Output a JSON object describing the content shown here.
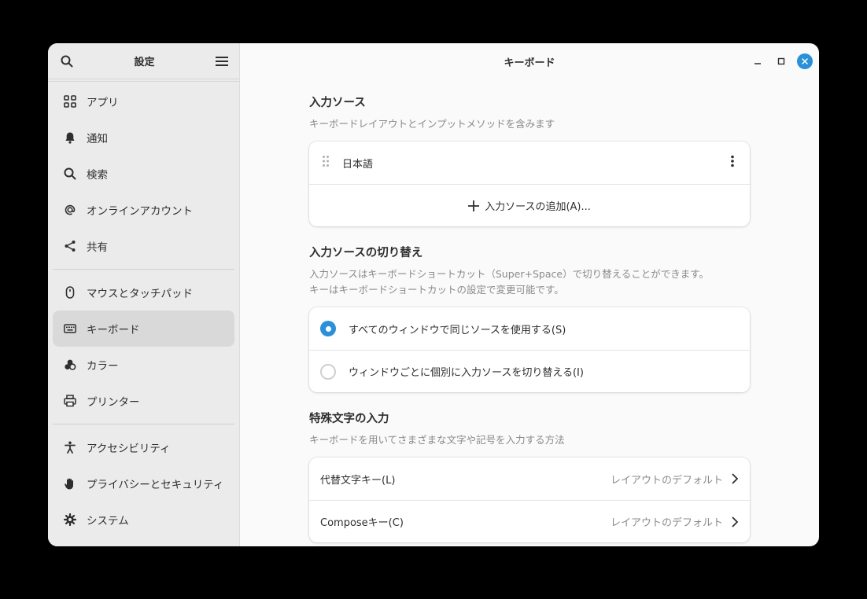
{
  "sidebar": {
    "title": "設定",
    "items": [
      {
        "label": "アプリ",
        "icon": "apps-grid-icon"
      },
      {
        "label": "通知",
        "icon": "bell-icon"
      },
      {
        "label": "検索",
        "icon": "search-icon"
      },
      {
        "label": "オンラインアカウント",
        "icon": "at-sign-icon"
      },
      {
        "label": "共有",
        "icon": "share-icon"
      },
      {
        "label": "マウスとタッチパッド",
        "icon": "mouse-icon"
      },
      {
        "label": "キーボード",
        "icon": "keyboard-icon"
      },
      {
        "label": "カラー",
        "icon": "color-icon"
      },
      {
        "label": "プリンター",
        "icon": "printer-icon"
      },
      {
        "label": "アクセシビリティ",
        "icon": "accessibility-icon"
      },
      {
        "label": "プライバシーとセキュリティ",
        "icon": "hand-icon"
      },
      {
        "label": "システム",
        "icon": "gear-icon"
      }
    ]
  },
  "main": {
    "title": "キーボード",
    "input_sources": {
      "title": "入力ソース",
      "desc": "キーボードレイアウトとインプットメソッドを含みます",
      "source": "日本語",
      "add_label": "入力ソースの追加(A)..."
    },
    "switching": {
      "title": "入力ソースの切り替え",
      "desc1": "入力ソースはキーボードショートカット（Super+Space）で切り替えることができます。",
      "desc2": "キーはキーボードショートカットの設定で変更可能です。",
      "option_same": "すべてのウィンドウで同じソースを使用する(S)",
      "option_per_window": "ウィンドウごとに個別に入力ソースを切り替える(I)"
    },
    "special": {
      "title": "特殊文字の入力",
      "desc": "キーボードを用いてさまざまな文字や記号を入力する方法",
      "alt_label": "代替文字キー(L)",
      "alt_value": "レイアウトのデフォルト",
      "compose_label": "Composeキー(C)",
      "compose_value": "レイアウトのデフォルト"
    }
  },
  "colors": {
    "accent": "#2a91d8"
  }
}
